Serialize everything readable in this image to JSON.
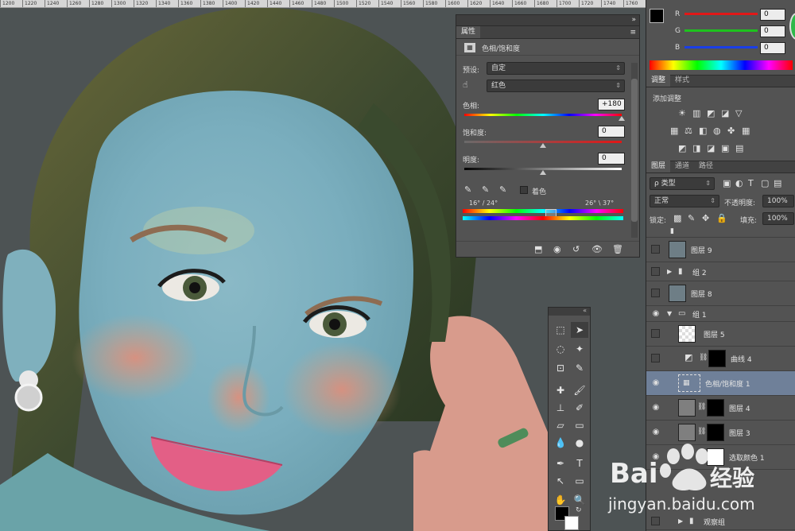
{
  "ruler": {
    "ticks": [
      "1200",
      "1220",
      "1240",
      "1260",
      "1280",
      "1300",
      "1320",
      "1340",
      "1360",
      "1380",
      "1400",
      "1420",
      "1440",
      "1460",
      "1480",
      "1500",
      "1520",
      "1540",
      "1560",
      "1580",
      "1600",
      "1620",
      "1640",
      "1660",
      "1680",
      "1700",
      "1720",
      "1740",
      "1760"
    ]
  },
  "properties": {
    "tab": "属性",
    "title": "色相/饱和度",
    "preset_label": "预设:",
    "preset_value": "自定",
    "channel_value": "红色",
    "hue_label": "色相:",
    "hue_value": "+180",
    "saturation_label": "饱和度:",
    "saturation_value": "0",
    "lightness_label": "明度:",
    "lightness_value": "0",
    "colorize_label": "着色",
    "range_left": "16° / 24°",
    "range_right": "26° \\ 37°",
    "hue_level": 1.0,
    "saturation_level": 0.5,
    "lightness_level": 0.5
  },
  "color_panel": {
    "r_label": "R",
    "g_label": "G",
    "b_label": "B",
    "r_value": "0",
    "g_value": "0",
    "b_value": "0"
  },
  "adjustments": {
    "tabs": [
      "调整",
      "样式"
    ],
    "title": "添加调整"
  },
  "layers": {
    "tabs": [
      "图层",
      "通道",
      "路径"
    ],
    "filter_label": "ρ 类型",
    "blend_mode": "正常",
    "opacity_label": "不透明度:",
    "opacity_value": "100%",
    "lock_label": "锁定:",
    "fill_label": "填充:",
    "fill_value": "100%",
    "items": [
      {
        "name": "图层 9"
      },
      {
        "name": "组 2"
      },
      {
        "name": "图层 8"
      },
      {
        "name": "组 1"
      },
      {
        "name": "图层 5"
      },
      {
        "name": "曲线 4"
      },
      {
        "name": "色相/饱和度 1"
      },
      {
        "name": "图层 4"
      },
      {
        "name": "图层 3"
      },
      {
        "name": "选取颜色 1"
      },
      {
        "name": "观察组"
      }
    ]
  },
  "watermark": {
    "brand": "Bai",
    "brand2": "经验",
    "url": "jingyan.baidu.com"
  }
}
